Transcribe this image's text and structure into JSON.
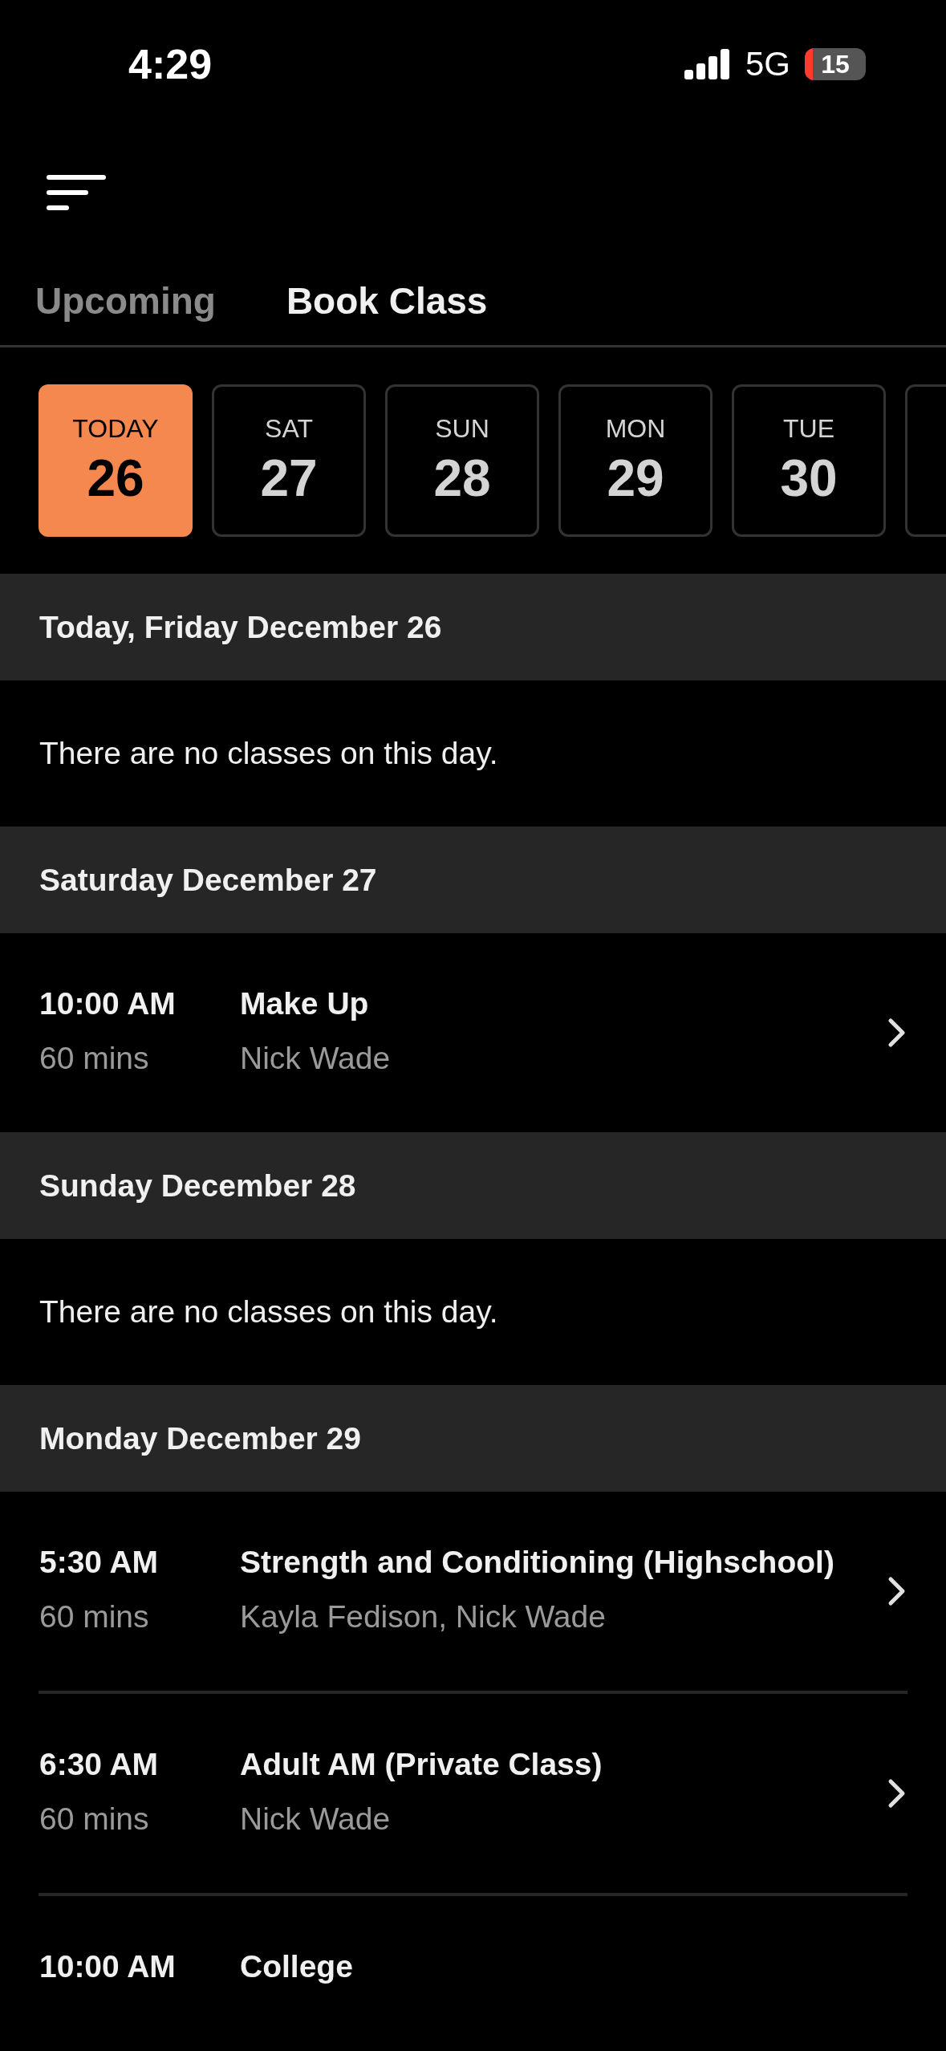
{
  "status_bar": {
    "time": "4:29",
    "network": "5G",
    "battery": "15"
  },
  "tabs": [
    {
      "label": "Upcoming",
      "selected": false
    },
    {
      "label": "Book Class",
      "selected": true
    }
  ],
  "dates": [
    {
      "day": "TODAY",
      "date": "26",
      "selected": true
    },
    {
      "day": "SAT",
      "date": "27",
      "selected": false
    },
    {
      "day": "SUN",
      "date": "28",
      "selected": false
    },
    {
      "day": "MON",
      "date": "29",
      "selected": false
    },
    {
      "day": "TUE",
      "date": "30",
      "selected": false
    }
  ],
  "sections": [
    {
      "heading": "Today, Friday December 26",
      "kind": "empty",
      "message": "There are no classes on this day."
    },
    {
      "heading": "Saturday December 27",
      "kind": "classes",
      "classes": [
        {
          "time": "10:00 AM",
          "duration": "60 mins",
          "title": "Make Up",
          "instructors": "Nick Wade"
        }
      ]
    },
    {
      "heading": "Sunday December 28",
      "kind": "empty",
      "message": "There are no classes on this day."
    },
    {
      "heading": "Monday December 29",
      "kind": "classes",
      "classes": [
        {
          "time": "5:30 AM",
          "duration": "60 mins",
          "title": "Strength and Conditioning (Highschool)",
          "instructors": "Kayla Fedison, Nick Wade"
        },
        {
          "time": "6:30 AM",
          "duration": "60 mins",
          "title": "Adult AM (Private Class)",
          "instructors": "Nick Wade"
        },
        {
          "time": "10:00 AM",
          "title": "College"
        }
      ]
    }
  ]
}
